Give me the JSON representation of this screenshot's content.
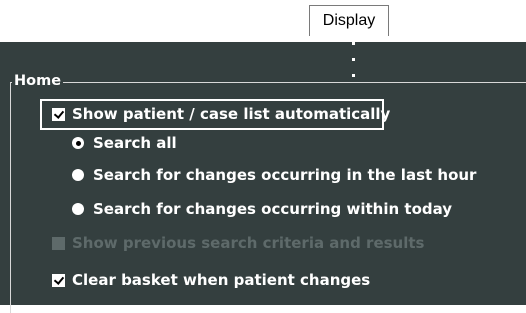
{
  "tab": {
    "label": "Display"
  },
  "group": {
    "title": "Home",
    "options": {
      "show_list": {
        "label": "Show patient / case list automatically",
        "checked": true,
        "enabled": true
      },
      "search_all": {
        "label": "Search all",
        "selected": true
      },
      "search_last_hour": {
        "label": "Search for changes occurring in the last hour",
        "selected": false
      },
      "search_today": {
        "label": "Search for changes occurring within today",
        "selected": false
      },
      "show_previous": {
        "label": "Show previous search criteria and results",
        "checked": false,
        "enabled": false
      },
      "clear_basket": {
        "label": "Clear basket when patient changes",
        "checked": true,
        "enabled": true
      }
    }
  }
}
